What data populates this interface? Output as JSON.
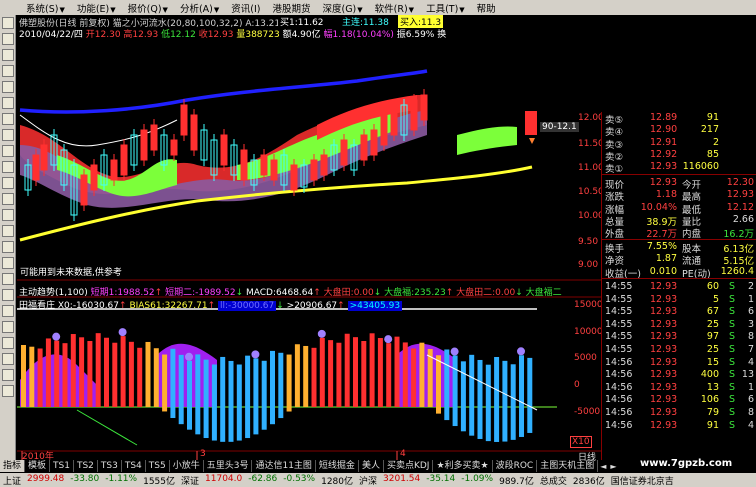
{
  "menu": [
    {
      "label": "系统(S)",
      "arrow": true
    },
    {
      "label": "功能(E)",
      "arrow": true
    },
    {
      "label": "报价(Q)",
      "arrow": true
    },
    {
      "label": "分析(A)",
      "arrow": true
    },
    {
      "label": "资讯(I)",
      "arrow": false
    },
    {
      "label": "港股期货",
      "arrow": false
    },
    {
      "label": "深度(G)",
      "arrow": true
    },
    {
      "label": "软件(R)",
      "arrow": true
    },
    {
      "label": "工具(T)",
      "arrow": true
    },
    {
      "label": "帮助",
      "arrow": false
    }
  ],
  "top_info": {
    "title": "佛塑股份(日线 前复权) 猫之小河流水(20,80,100,32,2) A:13.21",
    "buy1": "买1:11.62",
    "tag_zlian": "主连:11.38",
    "tag_buy": "买入:11.3"
  },
  "bar_info": {
    "date": "2010/04/22/四",
    "open": "开12.30",
    "high": "高12.93",
    "low": "低12.12",
    "close": "收12.93",
    "vol": "量388723",
    "amount": "额4.90亿",
    "change": "幅1.18(10.04%)",
    "swing": "振6.59%",
    "extra": "换"
  },
  "price_axis": [
    "12.00",
    "11.50",
    "11.00",
    "10.50",
    "10.00",
    "9.50",
    "9.00"
  ],
  "price_tag": "90-12.1",
  "future_note": "可能用到未来数据,供参考",
  "ind1": {
    "name": "主动趋势(1,100)",
    "short1": "短期1:1988.52",
    "short2": "短期二:-1989.52",
    "macd": "MACD:6468.64",
    "dpm": "大盘田:0.00",
    "dpf": "大盘福:235.23",
    "dpm2": "大盘田二:0.00",
    "dpf2": "大盘福二"
  },
  "ind2": {
    "name": "田福看庄",
    "x0": "X0:-16030.67",
    "bias": "BIAS61:32267.71",
    "box1": "ll:-30000.67",
    "val": ">20906.67",
    "box2": ">43405.93"
  },
  "ind_axis": [
    "15000",
    "10000",
    "5000",
    "0",
    "-5000"
  ],
  "x_labels": [
    "2010年",
    "3",
    "4"
  ],
  "x10": "X10",
  "quotes": {
    "sell": [
      {
        "label": "卖⑤",
        "price": "12.89",
        "vol": "91"
      },
      {
        "label": "卖④",
        "price": "12.90",
        "vol": "217"
      },
      {
        "label": "卖③",
        "price": "12.91",
        "vol": "2"
      },
      {
        "label": "卖②",
        "price": "12.92",
        "vol": "85"
      },
      {
        "label": "卖①",
        "price": "12.93",
        "vol": "116060"
      }
    ],
    "stats": [
      {
        "l1": "现价",
        "v1": "12.93",
        "l2": "今开",
        "v2": "12.30"
      },
      {
        "l1": "涨跌",
        "v1": "1.18",
        "l2": "最高",
        "v2": "12.93"
      },
      {
        "l1": "涨幅",
        "v1": "10.04%",
        "l2": "最低",
        "v2": "12.12"
      },
      {
        "l1": "总量",
        "v1": "38.9万",
        "l2": "量比",
        "v2": "2.66"
      },
      {
        "l1": "外盘",
        "v1": "22.7万",
        "l2": "内盘",
        "v2": "16.2万"
      }
    ],
    "stats2": [
      {
        "l1": "换手",
        "v1": "7.55%",
        "l2": "股本",
        "v2": "6.13亿"
      },
      {
        "l1": "净资",
        "v1": "1.87",
        "l2": "流通",
        "v2": "5.15亿"
      },
      {
        "l1": "收益(一)",
        "v1": "0.010",
        "l2": "PE(动)",
        "v2": "1260.4"
      }
    ]
  },
  "ticks": [
    {
      "time": "14:55",
      "price": "12.93",
      "vol": "60",
      "bs": "S",
      "n": "2"
    },
    {
      "time": "14:55",
      "price": "12.93",
      "vol": "5",
      "bs": "S",
      "n": "1"
    },
    {
      "time": "14:55",
      "price": "12.93",
      "vol": "67",
      "bs": "S",
      "n": "6"
    },
    {
      "time": "14:55",
      "price": "12.93",
      "vol": "25",
      "bs": "S",
      "n": "3"
    },
    {
      "time": "14:55",
      "price": "12.93",
      "vol": "97",
      "bs": "S",
      "n": "8"
    },
    {
      "time": "14:55",
      "price": "12.93",
      "vol": "25",
      "bs": "S",
      "n": "7"
    },
    {
      "time": "14:56",
      "price": "12.93",
      "vol": "15",
      "bs": "S",
      "n": "4"
    },
    {
      "time": "14:56",
      "price": "12.93",
      "vol": "400",
      "bs": "S",
      "n": "13"
    },
    {
      "time": "14:56",
      "price": "12.93",
      "vol": "13",
      "bs": "S",
      "n": "1"
    },
    {
      "time": "14:56",
      "price": "12.93",
      "vol": "106",
      "bs": "S",
      "n": "6"
    },
    {
      "time": "14:56",
      "price": "12.93",
      "vol": "79",
      "bs": "S",
      "n": "8"
    },
    {
      "time": "14:56",
      "price": "12.93",
      "vol": "91",
      "bs": "S",
      "n": "4"
    }
  ],
  "bottom_tabs": [
    "指标",
    "模板",
    "TS1",
    "TS2",
    "TS3",
    "TS4",
    "TS5",
    "小放牛",
    "五里头3号",
    "通达信11主图",
    "短线掘金",
    "美人",
    "买卖点KDJ",
    "★利多买卖★",
    "波段ROC",
    "主图天机主图"
  ],
  "bottom_right": "日线",
  "status": [
    {
      "label": "上证",
      "value": "2999.48",
      "chg": "-33.80",
      "pct": "-1.11%",
      "amt": "1555亿"
    },
    {
      "label": "深证",
      "value": "11704.0",
      "chg": "-62.86",
      "pct": "-0.53%",
      "amt": "1280亿"
    },
    {
      "label": "沪深",
      "value": "3201.54",
      "chg": "-35.14",
      "pct": "-1.09%",
      "amt": "989.7亿"
    }
  ],
  "status_extra": [
    "总成交",
    "2836亿",
    "国信证券北京吉"
  ],
  "watermark": "www.7gpzb.com",
  "colors": {
    "up": "#ff4040",
    "down": "#3ce63c",
    "bg": "#000000"
  }
}
